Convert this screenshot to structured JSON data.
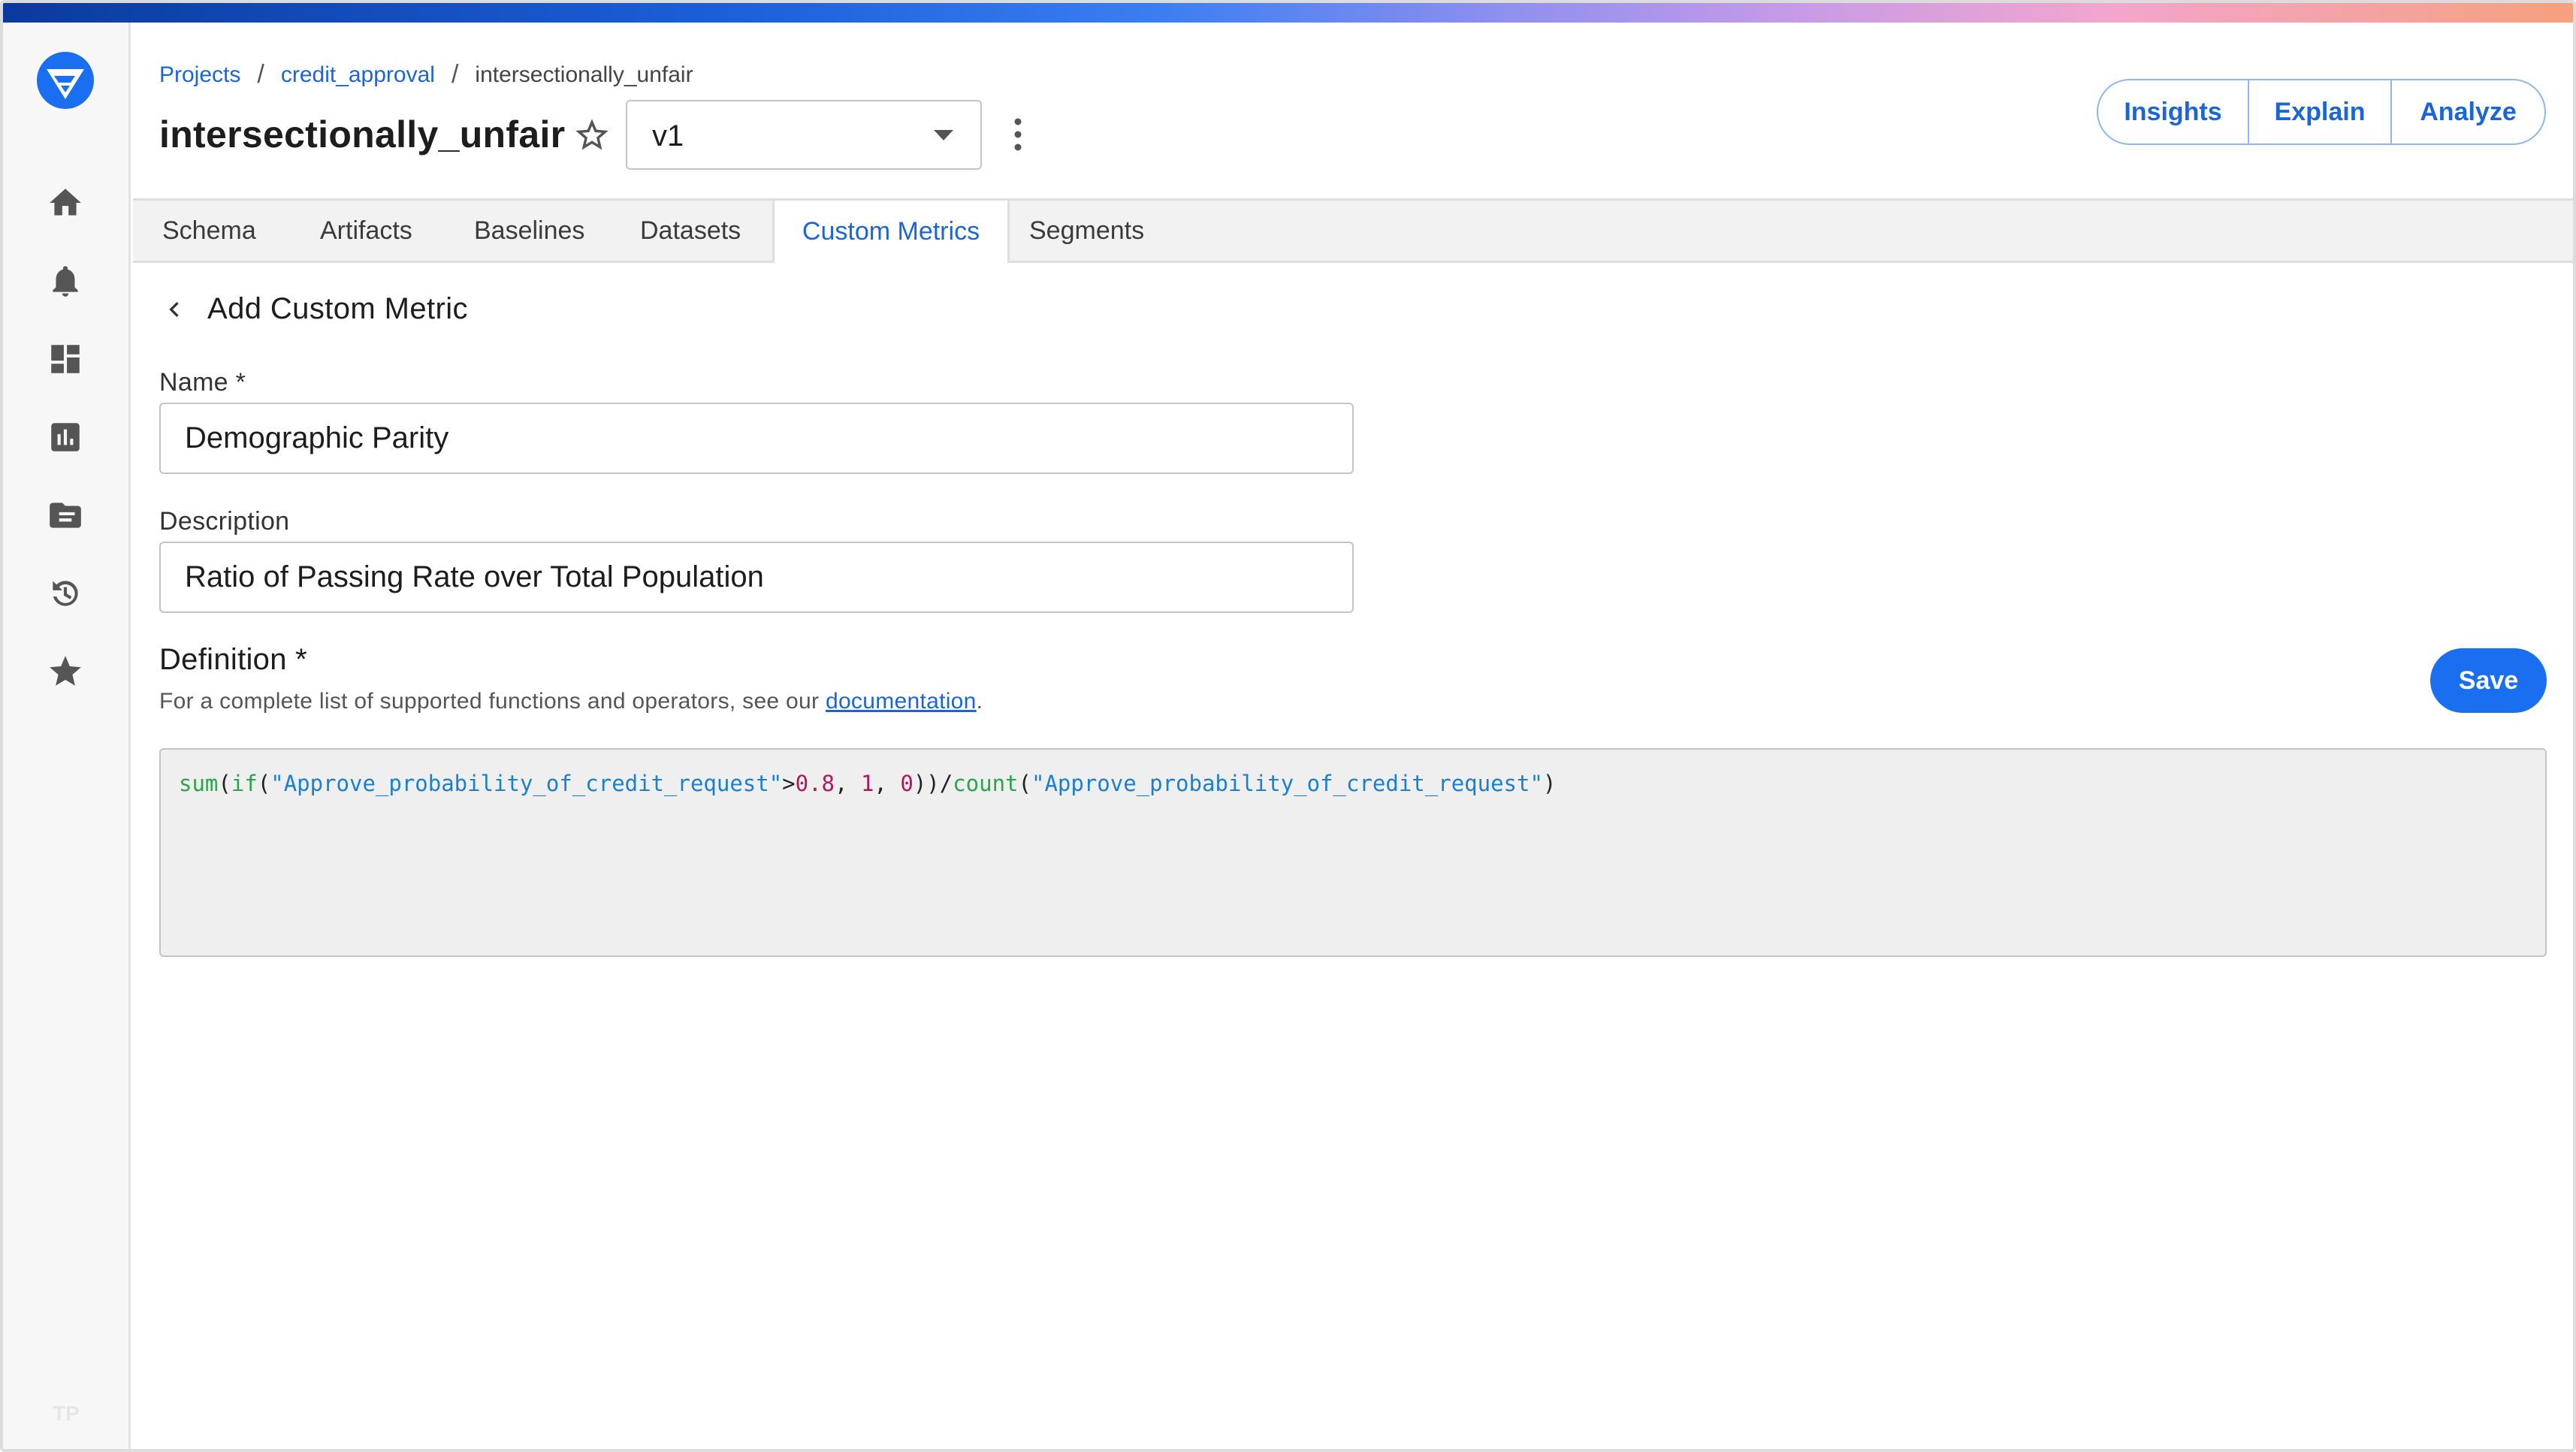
{
  "breadcrumb": {
    "items": [
      "Projects",
      "credit_approval"
    ],
    "current": "intersectionally_unfair",
    "separator": "/"
  },
  "header": {
    "title": "intersectionally_unfair",
    "version": "v1",
    "actions": [
      "Insights",
      "Explain",
      "Analyze"
    ]
  },
  "sidebar": {
    "icons": [
      "home-icon",
      "bell-icon",
      "dashboard-icon",
      "chart-icon",
      "folder-icon",
      "history-icon",
      "star-icon"
    ],
    "footer_badge": "TP"
  },
  "tabs": [
    "Schema",
    "Artifacts",
    "Baselines",
    "Datasets",
    "Custom Metrics",
    "Segments"
  ],
  "active_tab": "Custom Metrics",
  "form": {
    "heading": "Add Custom Metric",
    "name_label": "Name *",
    "name_value": "Demographic Parity",
    "description_label": "Description",
    "description_value": "Ratio of Passing Rate over Total Population",
    "definition_label": "Definition *",
    "definition_help_prefix": "For a complete list of supported functions and operators, see our ",
    "definition_help_link": "documentation",
    "definition_help_suffix": ".",
    "save_label": "Save",
    "code_tokens": [
      {
        "t": "fn",
        "v": "sum"
      },
      {
        "t": "op",
        "v": "("
      },
      {
        "t": "fn",
        "v": "if"
      },
      {
        "t": "op",
        "v": "("
      },
      {
        "t": "str",
        "v": "\"Approve_probability_of_credit_request\""
      },
      {
        "t": "op",
        "v": ">"
      },
      {
        "t": "num",
        "v": "0.8"
      },
      {
        "t": "op",
        "v": ", "
      },
      {
        "t": "num",
        "v": "1"
      },
      {
        "t": "op",
        "v": ", "
      },
      {
        "t": "num",
        "v": "0"
      },
      {
        "t": "op",
        "v": "))/"
      },
      {
        "t": "fn",
        "v": "count"
      },
      {
        "t": "op",
        "v": "("
      },
      {
        "t": "str",
        "v": "\"Approve_probability_of_credit_request\""
      },
      {
        "t": "op",
        "v": ")"
      }
    ]
  },
  "colors": {
    "accent": "#1a66d6",
    "save_button": "#1a6ff0",
    "code_function": "#2aa64a",
    "code_string": "#1a7fd0",
    "code_number": "#b3165c"
  }
}
